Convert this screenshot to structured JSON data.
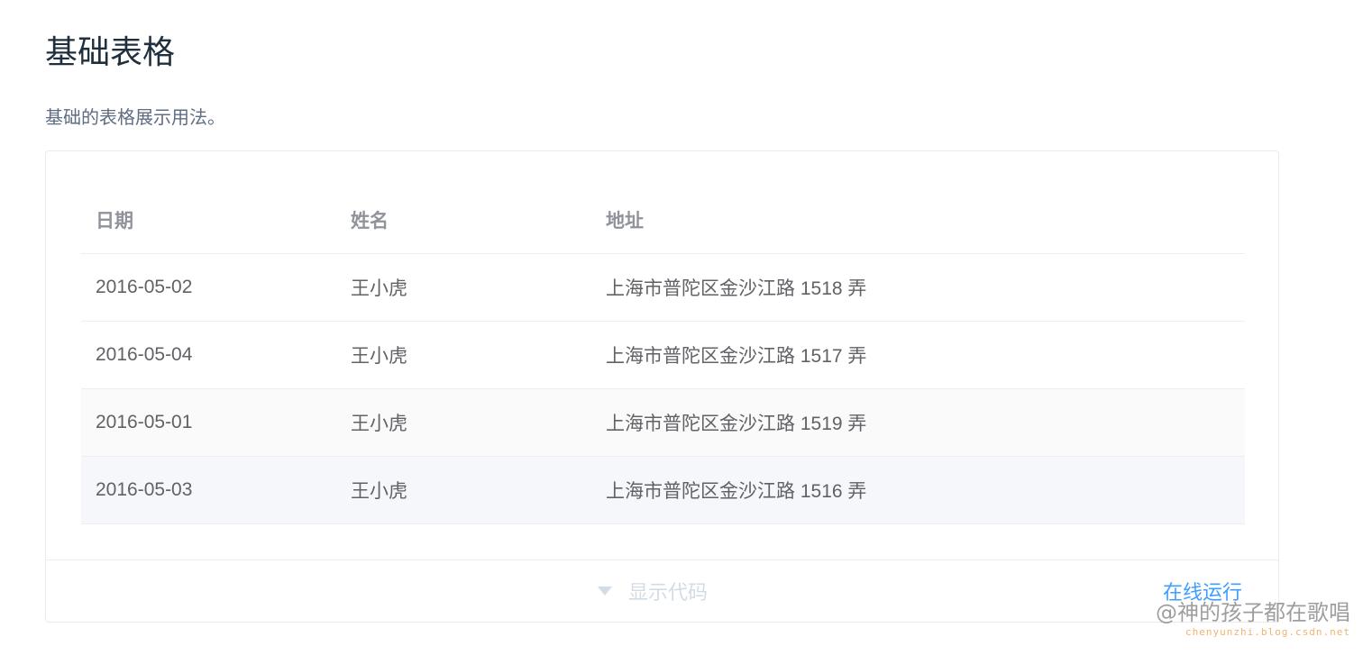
{
  "page": {
    "title": "基础表格",
    "description": "基础的表格展示用法。"
  },
  "table": {
    "headers": [
      "日期",
      "姓名",
      "地址"
    ],
    "rows": [
      [
        "2016-05-02",
        "王小虎",
        "上海市普陀区金沙江路 1518 弄"
      ],
      [
        "2016-05-04",
        "王小虎",
        "上海市普陀区金沙江路 1517 弄"
      ],
      [
        "2016-05-01",
        "王小虎",
        "上海市普陀区金沙江路 1519 弄"
      ],
      [
        "2016-05-03",
        "王小虎",
        "上海市普陀区金沙江路 1516 弄"
      ]
    ]
  },
  "footer": {
    "toggle_label": "显示代码",
    "toggle_icon": "caret-down-icon",
    "run_label": "在线运行"
  },
  "watermark": {
    "main": "@神的孩子都在歌唱",
    "sub": "chenyunzhi.blog.csdn.net"
  },
  "colors": {
    "title": "#1f2f3d",
    "description": "#5e6d82",
    "header_text": "#909399",
    "cell_text": "#606266",
    "link": "#409eff",
    "toggle": "#d3dce6",
    "border": "#ebeef5",
    "hover_row": "#f5f7fa"
  }
}
